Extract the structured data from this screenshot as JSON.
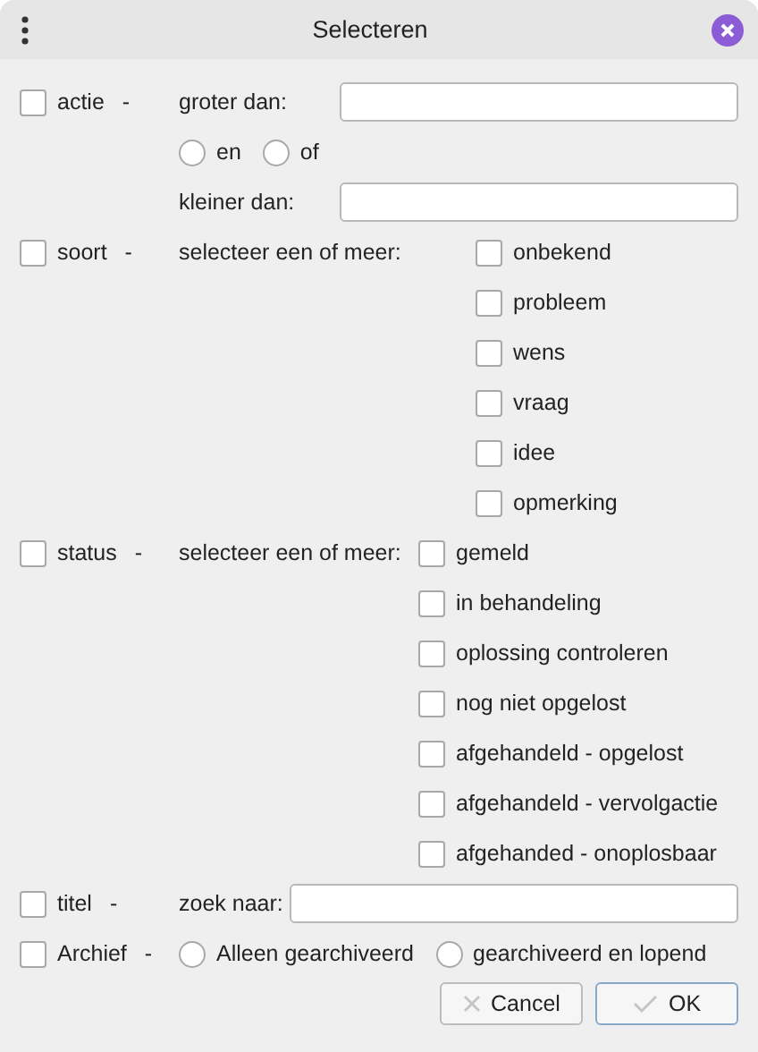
{
  "window": {
    "title": "Selecteren"
  },
  "filters": [
    {
      "kind": "range",
      "label": "actie",
      "separator": "-",
      "checked": false,
      "greater_label": "groter dan:",
      "radios": [
        {
          "label": "en",
          "selected": false
        },
        {
          "label": "of",
          "selected": false
        }
      ],
      "smaller_label": "kleiner dan:"
    },
    {
      "kind": "multi",
      "label": "soort",
      "separator": "-",
      "checked": false,
      "prompt": "selecteer een of meer:",
      "options": [
        {
          "label": "onbekend",
          "checked": false
        },
        {
          "label": "probleem",
          "checked": false
        },
        {
          "label": "wens",
          "checked": false
        },
        {
          "label": "vraag",
          "checked": false
        },
        {
          "label": "idee",
          "checked": false
        },
        {
          "label": "opmerking",
          "checked": false
        }
      ]
    },
    {
      "kind": "multi",
      "label": "status",
      "separator": "-",
      "checked": false,
      "prompt": "selecteer een of meer:",
      "options": [
        {
          "label": "gemeld",
          "checked": false
        },
        {
          "label": "in behandeling",
          "checked": false
        },
        {
          "label": "oplossing controleren",
          "checked": false
        },
        {
          "label": "nog niet opgelost",
          "checked": false
        },
        {
          "label": "afgehandeld - opgelost",
          "checked": false
        },
        {
          "label": "afgehandeld - vervolgactie",
          "checked": false
        },
        {
          "label": "afgehanded - onoplosbaar",
          "checked": false
        }
      ]
    },
    {
      "kind": "search",
      "label": "titel",
      "separator": "-",
      "checked": false,
      "prompt": "zoek naar:"
    },
    {
      "kind": "choice",
      "label": "Archief",
      "separator": "-",
      "checked": false,
      "radios": [
        {
          "label": "Alleen gearchiveerd",
          "selected": false
        },
        {
          "label": "gearchiveerd en lopend",
          "selected": false
        }
      ]
    }
  ],
  "buttons": [
    {
      "kind": "cancel",
      "label": "Cancel"
    },
    {
      "kind": "ok",
      "label": "OK"
    }
  ]
}
